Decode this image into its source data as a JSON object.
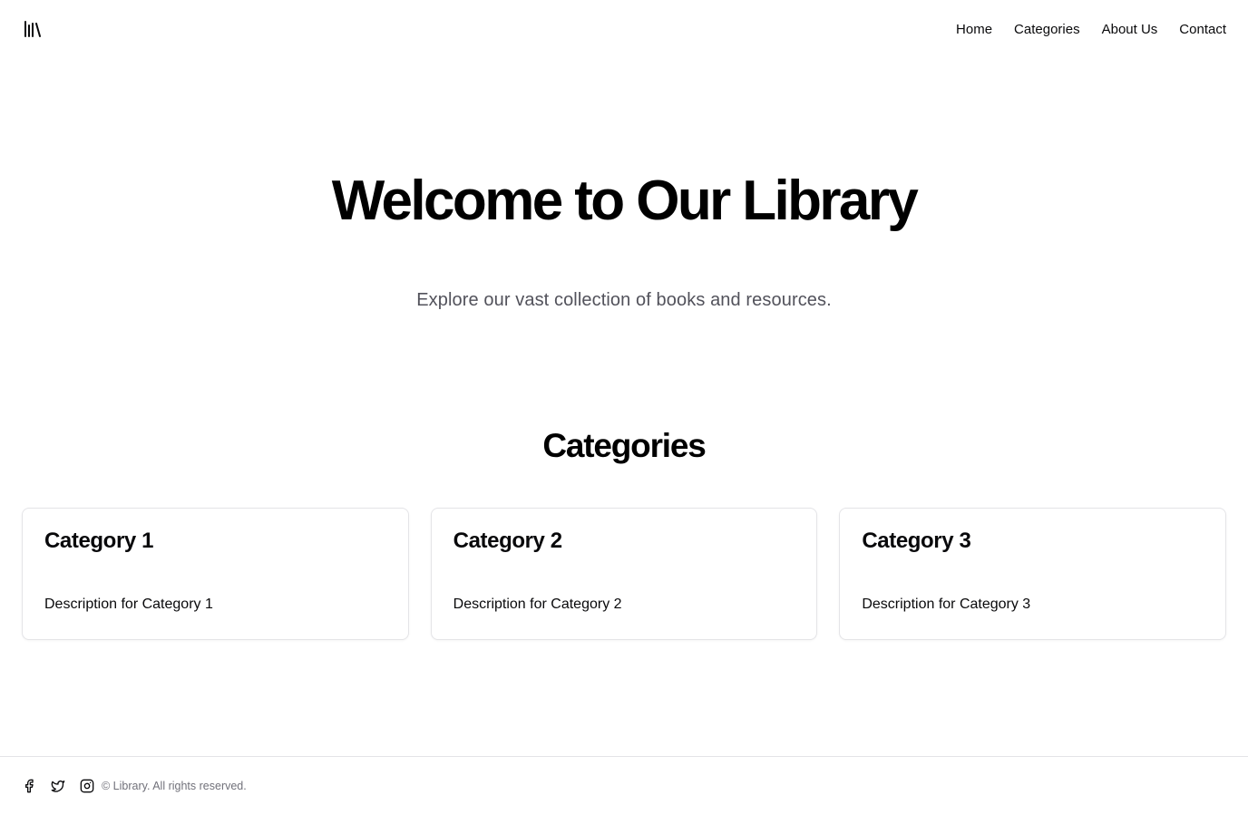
{
  "header": {
    "logo_icon": "library-icon",
    "nav": [
      {
        "label": "Home"
      },
      {
        "label": "Categories"
      },
      {
        "label": "About Us"
      },
      {
        "label": "Contact"
      }
    ]
  },
  "hero": {
    "title": "Welcome to Our Library",
    "subtitle": "Explore our vast collection of books and resources."
  },
  "categories": {
    "title": "Categories",
    "items": [
      {
        "name": "Category 1",
        "description": "Description for Category 1"
      },
      {
        "name": "Category 2",
        "description": "Description for Category 2"
      },
      {
        "name": "Category 3",
        "description": "Description for Category 3"
      }
    ]
  },
  "footer": {
    "social_icons": [
      "facebook-icon",
      "twitter-icon",
      "instagram-icon"
    ],
    "copyright": "© Library. All rights reserved."
  },
  "colors": {
    "text": "#09090b",
    "muted": "#52525b",
    "footer_text": "#71717a",
    "border": "#e4e4e7",
    "background": "#ffffff"
  }
}
